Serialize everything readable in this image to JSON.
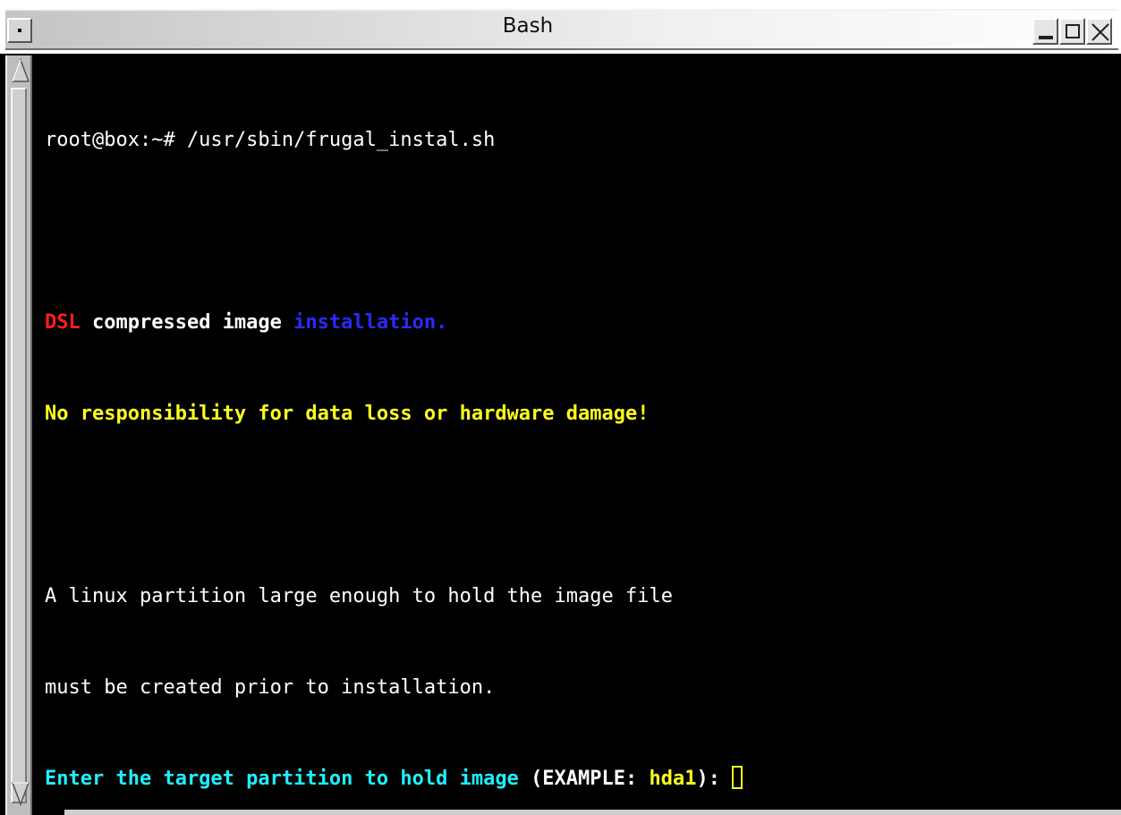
{
  "window": {
    "title": "Bash"
  },
  "colors": {
    "red": "#ff1e1e",
    "blue": "#2a2aff",
    "yellow": "#ffff1e",
    "cyan": "#1ef0ff",
    "white": "#ffffff",
    "background": "#000000"
  },
  "icons": {
    "menu": "window-menu-icon",
    "minimize": "minimize-icon",
    "maximize": "maximize-icon",
    "close": "close-icon",
    "scroll_up": "scroll-up-arrow-icon",
    "scroll_down": "scroll-down-arrow-icon"
  },
  "terminal": {
    "command_line": "root@box:~# /usr/sbin/frugal_instal.sh",
    "line2": {
      "dsl": "DSL",
      "compressed": " compressed image ",
      "installation": "installation."
    },
    "warning": "No responsibility for data loss or hardware damage!",
    "info_line1": "A linux partition large enough to hold the image file",
    "info_line2": "must be created prior to installation.",
    "prompt": {
      "question": "Enter the target partition to hold image ",
      "example_open": "(EXAMPLE: ",
      "example_value": "hda1",
      "example_close": "): "
    }
  }
}
